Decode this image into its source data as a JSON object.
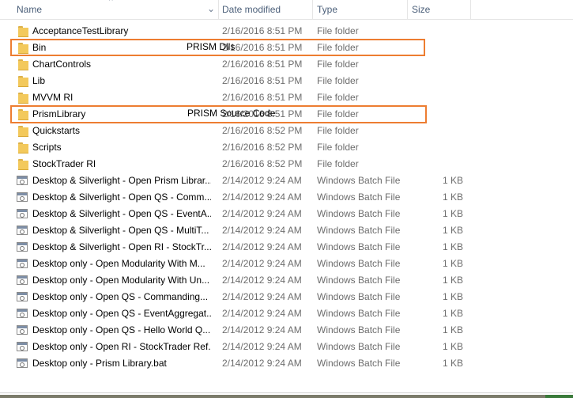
{
  "columns": {
    "name": "Name",
    "date_modified": "Date modified",
    "type": "Type",
    "size": "Size"
  },
  "rows": [
    {
      "name": "AcceptanceTestLibrary",
      "date": "2/16/2016 8:51 PM",
      "type": "File folder",
      "size": "",
      "icon": "folder-icon"
    },
    {
      "name": "Bin",
      "date": "2/16/2016 8:51 PM",
      "type": "File folder",
      "size": "",
      "icon": "folder-icon"
    },
    {
      "name": "ChartControls",
      "date": "2/16/2016 8:51 PM",
      "type": "File folder",
      "size": "",
      "icon": "folder-icon"
    },
    {
      "name": "Lib",
      "date": "2/16/2016 8:51 PM",
      "type": "File folder",
      "size": "",
      "icon": "folder-icon"
    },
    {
      "name": "MVVM RI",
      "date": "2/16/2016 8:51 PM",
      "type": "File folder",
      "size": "",
      "icon": "folder-icon"
    },
    {
      "name": "PrismLibrary",
      "date": "2/16/2016 8:51 PM",
      "type": "File folder",
      "size": "",
      "icon": "folder-icon"
    },
    {
      "name": "Quickstarts",
      "date": "2/16/2016 8:52 PM",
      "type": "File folder",
      "size": "",
      "icon": "folder-icon"
    },
    {
      "name": "Scripts",
      "date": "2/16/2016 8:52 PM",
      "type": "File folder",
      "size": "",
      "icon": "folder-icon"
    },
    {
      "name": "StockTrader RI",
      "date": "2/16/2016 8:52 PM",
      "type": "File folder",
      "size": "",
      "icon": "folder-icon"
    },
    {
      "name": "Desktop & Silverlight - Open Prism Librar...",
      "date": "2/14/2012 9:24 AM",
      "type": "Windows Batch File",
      "size": "1 KB",
      "icon": "batch-file-icon"
    },
    {
      "name": "Desktop & Silverlight - Open QS - Comm...",
      "date": "2/14/2012 9:24 AM",
      "type": "Windows Batch File",
      "size": "1 KB",
      "icon": "batch-file-icon"
    },
    {
      "name": "Desktop & Silverlight - Open QS - EventA...",
      "date": "2/14/2012 9:24 AM",
      "type": "Windows Batch File",
      "size": "1 KB",
      "icon": "batch-file-icon"
    },
    {
      "name": "Desktop & Silverlight - Open QS - MultiT...",
      "date": "2/14/2012 9:24 AM",
      "type": "Windows Batch File",
      "size": "1 KB",
      "icon": "batch-file-icon"
    },
    {
      "name": "Desktop & Silverlight - Open RI - StockTr...",
      "date": "2/14/2012 9:24 AM",
      "type": "Windows Batch File",
      "size": "1 KB",
      "icon": "batch-file-icon"
    },
    {
      "name": "Desktop only - Open Modularity With M...",
      "date": "2/14/2012 9:24 AM",
      "type": "Windows Batch File",
      "size": "1 KB",
      "icon": "batch-file-icon"
    },
    {
      "name": "Desktop only - Open Modularity With Un...",
      "date": "2/14/2012 9:24 AM",
      "type": "Windows Batch File",
      "size": "1 KB",
      "icon": "batch-file-icon"
    },
    {
      "name": "Desktop only - Open QS - Commanding...",
      "date": "2/14/2012 9:24 AM",
      "type": "Windows Batch File",
      "size": "1 KB",
      "icon": "batch-file-icon"
    },
    {
      "name": "Desktop only - Open QS - EventAggregat...",
      "date": "2/14/2012 9:24 AM",
      "type": "Windows Batch File",
      "size": "1 KB",
      "icon": "batch-file-icon"
    },
    {
      "name": "Desktop only - Open QS - Hello World Q...",
      "date": "2/14/2012 9:24 AM",
      "type": "Windows Batch File",
      "size": "1 KB",
      "icon": "batch-file-icon"
    },
    {
      "name": "Desktop only - Open RI - StockTrader Ref...",
      "date": "2/14/2012 9:24 AM",
      "type": "Windows Batch File",
      "size": "1 KB",
      "icon": "batch-file-icon"
    },
    {
      "name": "Desktop only - Prism Library.bat",
      "date": "2/14/2012 9:24 AM",
      "type": "Windows Batch File",
      "size": "1 KB",
      "icon": "batch-file-icon"
    }
  ],
  "annotations": {
    "bin_label": "PRISM Dlls",
    "prism_library_label": "PRISM Source Code",
    "highlight_color": "#ed7d31"
  }
}
